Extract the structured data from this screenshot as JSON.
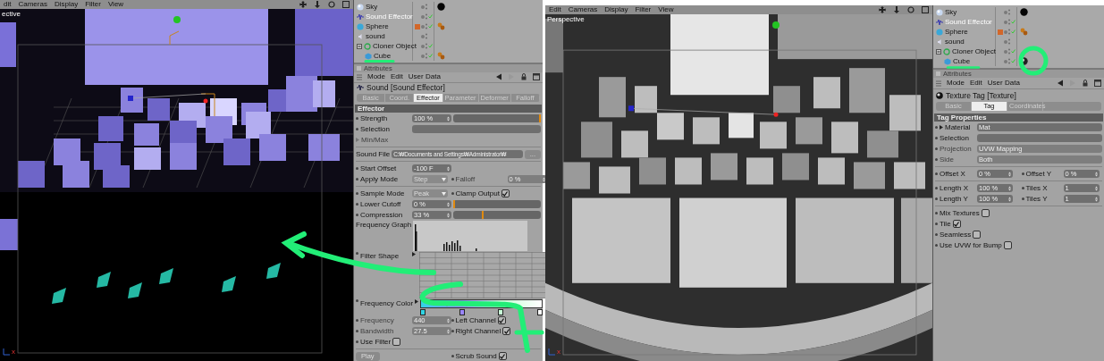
{
  "left": {
    "viewport": {
      "menu": [
        "dit",
        "Cameras",
        "Display",
        "Filter",
        "View"
      ],
      "view_label": "ective",
      "axis_label": "x"
    },
    "objects": [
      {
        "name": "Sky",
        "kind": "sky",
        "selected": false,
        "checked": false,
        "tags": [
          {
            "kind": "material"
          }
        ]
      },
      {
        "name": "Sound Effector",
        "kind": "effector",
        "selected": true,
        "checked": true
      },
      {
        "name": "Sphere",
        "kind": "sphere",
        "selected": false,
        "checked": true,
        "color": "#d2672a",
        "tags": [
          {
            "kind": "phong"
          }
        ]
      },
      {
        "name": "sound",
        "kind": "sound",
        "selected": false,
        "checked": false
      },
      {
        "name": "Cloner Object",
        "kind": "cloner",
        "selected": false,
        "checked": true,
        "expanded": true,
        "children": [
          {
            "name": "Cube",
            "kind": "cube",
            "selected": false,
            "checked": true,
            "tags": [
              {
                "kind": "phong"
              }
            ]
          }
        ]
      }
    ],
    "attributes": {
      "header": "Attributes",
      "menu": [
        "Mode",
        "Edit",
        "User Data"
      ],
      "kind": "sound_effector",
      "title": "Sound [Sound Effector]",
      "tabs": [
        {
          "label": "Basic",
          "selected": false
        },
        {
          "label": "Coord.",
          "selected": false
        },
        {
          "label": "Effector",
          "selected": true
        },
        {
          "label": "Parameter",
          "selected": false
        },
        {
          "label": "Deformer",
          "selected": false
        },
        {
          "label": "Falloff",
          "selected": false
        }
      ],
      "section": "Effector",
      "rows": [
        {
          "cells": [
            {
              "kind": "slider",
              "label": "Strength",
              "value": "100 %",
              "level": 1
            }
          ]
        },
        {
          "cells": [
            {
              "kind": "field",
              "label": "Selection"
            }
          ]
        },
        {
          "cells": [
            {
              "kind": "group",
              "label": "Min/Max",
              "expanded": false
            }
          ]
        },
        {
          "kind": "divider"
        },
        {
          "cells": [
            {
              "kind": "file",
              "label": "Sound File",
              "value": "C:₩Documents and Settings₩Administrator₩",
              "button": "..."
            }
          ]
        },
        {
          "kind": "divider"
        },
        {
          "cells": [
            {
              "kind": "number",
              "label": "Start Offset",
              "value": "-100 F",
              "disabled": false
            }
          ]
        },
        {
          "cells": [
            {
              "kind": "dropdown",
              "label": "Apply Mode",
              "value": "Step"
            },
            {
              "kind": "number",
              "label": "Falloff",
              "value": "0 %",
              "disabled": true
            }
          ]
        },
        {
          "kind": "divider"
        },
        {
          "cells": [
            {
              "kind": "dropdown",
              "label": "Sample Mode",
              "value": "Peak"
            },
            {
              "kind": "check",
              "label": "Clamp Output",
              "checked": true
            }
          ]
        },
        {
          "cells": [
            {
              "kind": "slider",
              "label": "Lower Cutoff",
              "value": "0 %",
              "level": 0
            }
          ]
        },
        {
          "cells": [
            {
              "kind": "slider",
              "label": "Compression",
              "value": "33 %",
              "level": 0.33
            }
          ]
        },
        {
          "cells": [
            {
              "kind": "graph",
              "label": "Frequency Graph"
            }
          ]
        },
        {
          "cells": [
            {
              "kind": "grid",
              "label": "Filter Shape"
            }
          ]
        },
        {
          "cells": [
            {
              "kind": "gradient",
              "label": "Frequency Color",
              "stops": [
                {
                  "color": "#30d4e4"
                },
                {
                  "color": "#9a86ff"
                },
                {
                  "color": "#c8ffd8"
                },
                {
                  "color": "#ffffff"
                }
              ]
            }
          ]
        },
        {
          "cells": [
            {
              "kind": "number",
              "label": "Frequency",
              "value": "440",
              "disabled": true
            },
            {
              "kind": "check",
              "label": "Left Channel",
              "checked": true
            }
          ]
        },
        {
          "cells": [
            {
              "kind": "number",
              "label": "Bandwidth",
              "value": "27.5",
              "disabled": true
            },
            {
              "kind": "check",
              "label": "Right Channel",
              "checked": true
            }
          ]
        },
        {
          "cells": [
            {
              "kind": "check",
              "label": "Use Filter",
              "checked": false
            }
          ]
        },
        {
          "kind": "divider"
        },
        {
          "cells": [
            {
              "kind": "button",
              "label": "Play"
            },
            {
              "kind": "check",
              "label": "Scrub Sound",
              "checked": true
            }
          ]
        }
      ]
    }
  },
  "right": {
    "viewport": {
      "menu": [
        "Edit",
        "Cameras",
        "Display",
        "Filter",
        "View"
      ],
      "view_label": "Perspective",
      "axis_label": "x"
    },
    "objects": [
      {
        "name": "Sky",
        "kind": "sky",
        "selected": false,
        "checked": false,
        "tags": [
          {
            "kind": "material"
          }
        ]
      },
      {
        "name": "Sound Effector",
        "kind": "effector",
        "selected": true,
        "checked": true
      },
      {
        "name": "Sphere",
        "kind": "sphere",
        "selected": false,
        "checked": true,
        "color": "#d2672a",
        "tags": [
          {
            "kind": "phong"
          }
        ]
      },
      {
        "name": "sound",
        "kind": "sound",
        "selected": false,
        "checked": false
      },
      {
        "name": "Cloner Object",
        "kind": "cloner",
        "selected": false,
        "checked": true,
        "expanded": true,
        "children": [
          {
            "name": "Cube",
            "kind": "cube",
            "selected": false,
            "checked": true,
            "tags": [
              {
                "kind": "texture"
              }
            ]
          }
        ]
      }
    ],
    "attributes": {
      "header": "Attributes",
      "menu": [
        "Mode",
        "Edit",
        "User Data"
      ],
      "kind": "texture_tag",
      "title": "Texture Tag [Texture]",
      "tabs": [
        {
          "label": "Basic",
          "selected": false
        },
        {
          "label": "Tag",
          "selected": true
        },
        {
          "label": "Coordinates",
          "selected": false
        }
      ],
      "section": "Tag Properties",
      "rows": [
        {
          "cells": [
            {
              "kind": "link",
              "label": "Material",
              "value": "Mat"
            }
          ]
        },
        {
          "cells": [
            {
              "kind": "field",
              "label": "Selection"
            }
          ]
        },
        {
          "cells": [
            {
              "kind": "field",
              "label": "Projection",
              "value": "UVW Mapping",
              "disabled": true
            }
          ]
        },
        {
          "cells": [
            {
              "kind": "field",
              "label": "Side",
              "value": "Both",
              "disabled": true
            }
          ]
        },
        {
          "kind": "divider"
        },
        {
          "cells": [
            {
              "kind": "number",
              "label": "Offset X",
              "value": "0 %",
              "disabled": false
            },
            {
              "kind": "number",
              "label": "Offset Y",
              "value": "0 %",
              "disabled": false
            }
          ]
        },
        {
          "kind": "divider"
        },
        {
          "cells": [
            {
              "kind": "number",
              "label": "Length X",
              "value": "100 %",
              "disabled": false
            },
            {
              "kind": "number",
              "label": "Tiles X",
              "value": "1",
              "disabled": false
            }
          ]
        },
        {
          "cells": [
            {
              "kind": "number",
              "label": "Length Y",
              "value": "100 %",
              "disabled": false
            },
            {
              "kind": "number",
              "label": "Tiles Y",
              "value": "1",
              "disabled": false
            }
          ]
        },
        {
          "kind": "divider"
        },
        {
          "cells": [
            {
              "kind": "check",
              "label": "Mix Textures",
              "checked": false
            }
          ]
        },
        {
          "cells": [
            {
              "kind": "check",
              "label": "Tile",
              "checked": true
            }
          ]
        },
        {
          "cells": [
            {
              "kind": "check",
              "label": "Seamless",
              "checked": false
            }
          ]
        },
        {
          "cells": [
            {
              "kind": "check",
              "label": "Use UVW for Bump",
              "checked": false
            }
          ]
        }
      ]
    }
  }
}
